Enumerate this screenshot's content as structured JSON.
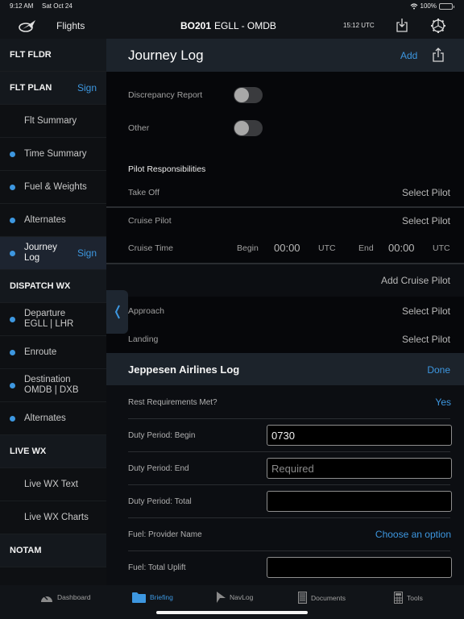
{
  "status_bar": {
    "time": "9:12 AM",
    "date": "Sat Oct 24",
    "battery": "100%"
  },
  "nav": {
    "flights_label": "Flights",
    "flight_number": "BO201",
    "route": "EGLL - OMDB",
    "utc_time": "15:12 UTC",
    "icons": [
      "logo-icon",
      "download-icon",
      "gear-icon"
    ]
  },
  "sidebar": {
    "items": [
      {
        "label": "FLT FLDR",
        "type": "section"
      },
      {
        "label": "FLT PLAN",
        "type": "section",
        "action": "Sign"
      },
      {
        "label": "Flt Summary",
        "type": "item",
        "dot": false
      },
      {
        "label": "Time Summary",
        "type": "item",
        "dot": true
      },
      {
        "label": "Fuel & Weights",
        "type": "item",
        "dot": true
      },
      {
        "label": "Alternates",
        "type": "item",
        "dot": true
      },
      {
        "label_line1": "Journey",
        "label_line2": "Log",
        "type": "item",
        "dot": true,
        "selected": true,
        "action": "Sign"
      },
      {
        "label": "DISPATCH WX",
        "type": "section"
      },
      {
        "label_line1": "Departure",
        "label_line2": "EGLL | LHR",
        "type": "item",
        "dot": true
      },
      {
        "label": "Enroute",
        "type": "item",
        "dot": true
      },
      {
        "label_line1": "Destination",
        "label_line2": "OMDB | DXB",
        "type": "item",
        "dot": true
      },
      {
        "label": "Alternates",
        "type": "item",
        "dot": true
      },
      {
        "label": "LIVE WX",
        "type": "section"
      },
      {
        "label": "Live WX Text",
        "type": "item",
        "dot": false
      },
      {
        "label": "Live WX Charts",
        "type": "item",
        "dot": false
      },
      {
        "label": "NOTAM",
        "type": "section"
      }
    ]
  },
  "main": {
    "title": "Journey Log",
    "add_label": "Add",
    "toggles": [
      {
        "label": "Discrepancy Report",
        "on": false
      },
      {
        "label": "Other",
        "on": false
      }
    ],
    "pilot_section_title": "Pilot Responsibilities",
    "take_off": {
      "label": "Take Off",
      "value": "Select Pilot"
    },
    "cruise_pilot": {
      "label": "Cruise Pilot",
      "value": "Select Pilot"
    },
    "cruise_time": {
      "label": "Cruise Time",
      "begin_label": "Begin",
      "begin_value": "00:00",
      "begin_unit": "UTC",
      "end_label": "End",
      "end_value": "00:00",
      "end_unit": "UTC"
    },
    "add_cruise_pilot": "Add Cruise Pilot",
    "approach": {
      "label": "Approach",
      "value": "Select Pilot"
    },
    "landing": {
      "label": "Landing",
      "value": "Select Pilot"
    },
    "airline_log": {
      "title": "Jeppesen Airlines Log",
      "done_label": "Done",
      "rest_requirements": {
        "label": "Rest Requirements Met?",
        "value": "Yes"
      },
      "duty_begin": {
        "label": "Duty Period: Begin",
        "value": "0730",
        "placeholder": ""
      },
      "duty_end": {
        "label": "Duty Period: End",
        "value": "",
        "placeholder": "Required"
      },
      "duty_total": {
        "label": "Duty Period: Total",
        "value": "",
        "placeholder": ""
      },
      "fuel_provider": {
        "label": "Fuel: Provider Name",
        "value": "Choose an option"
      },
      "fuel_uplift": {
        "label": "Fuel: Total Uplift",
        "value": "",
        "placeholder": ""
      }
    }
  },
  "tabbar": {
    "tabs": [
      {
        "label": "Dashboard",
        "icon": "gauge-icon",
        "active": false
      },
      {
        "label": "Briefing",
        "icon": "folder-icon",
        "active": true
      },
      {
        "label": "NavLog",
        "icon": "navigation-arrow-icon",
        "active": false
      },
      {
        "label": "Documents",
        "icon": "document-icon",
        "active": false
      },
      {
        "label": "Tools",
        "icon": "calculator-icon",
        "active": false
      }
    ]
  },
  "colors": {
    "accent": "#3d97e0",
    "header_bg": "#1c232b",
    "background": "#06070a"
  }
}
